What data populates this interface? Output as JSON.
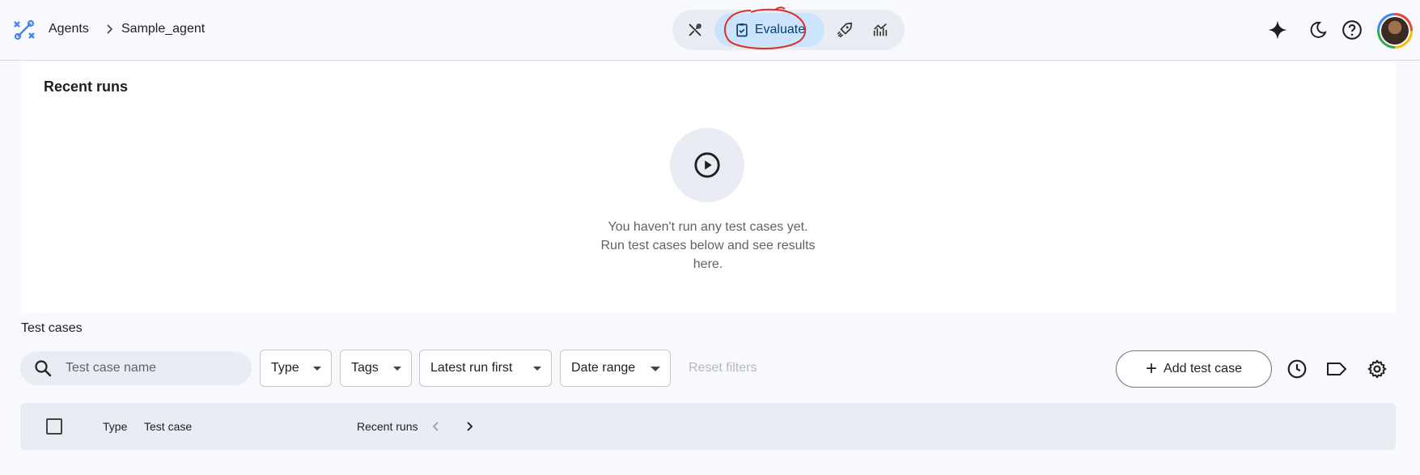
{
  "header": {
    "breadcrumb": [
      "Agents",
      "Sample_agent"
    ],
    "tabs": [
      {
        "id": "build",
        "icon": "tools-icon"
      },
      {
        "id": "evaluate",
        "label": "Evaluate",
        "icon": "clipboard-check-icon",
        "active": true
      },
      {
        "id": "deploy",
        "icon": "rocket-icon"
      },
      {
        "id": "monitor",
        "icon": "analytics-icon"
      }
    ],
    "actions": [
      "sparkle-icon",
      "moon-icon",
      "help-icon",
      "avatar"
    ]
  },
  "recent_runs": {
    "title": "Recent runs",
    "empty_line1": "You haven't run any test cases yet.",
    "empty_line2": "Run test cases below and see results",
    "empty_line3": "here."
  },
  "test_cases": {
    "title": "Test cases",
    "search_placeholder": "Test case name",
    "filters": {
      "type": "Type",
      "tags": "Tags",
      "sort": "Latest run first",
      "date_range": "Date range"
    },
    "reset_filters": "Reset filters",
    "add_button": "Add test case",
    "columns": {
      "type": "Type",
      "test_case": "Test case",
      "recent_runs": "Recent runs"
    }
  },
  "colors": {
    "accent": "#0b57d0",
    "active_tab_bg": "#cce4fb",
    "annotation": "#d93025"
  }
}
